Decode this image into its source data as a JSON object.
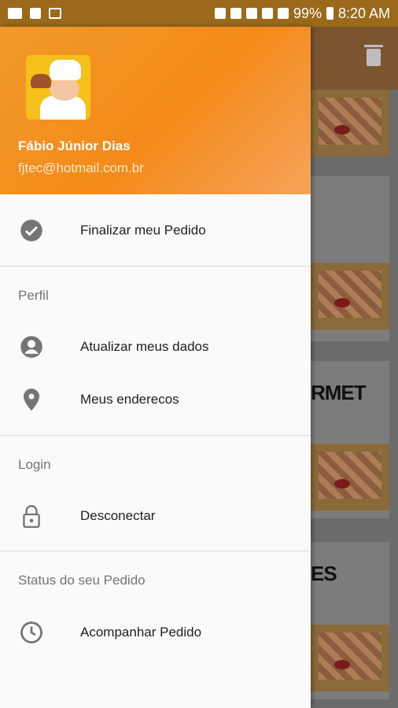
{
  "status_bar": {
    "battery": "99%",
    "time": "8:20 AM"
  },
  "drawer": {
    "user": {
      "name": "Fábio Júnior Dias",
      "email": "fjtec@hotmail.com.br"
    },
    "menu": {
      "finalize_order": "Finalizar meu Pedido",
      "profile_section": "Perfil",
      "update_data": "Atualizar meus dados",
      "my_addresses": "Meus enderecos",
      "login_section": "Login",
      "disconnect": "Desconectar",
      "order_status_section": "Status do seu Pedido",
      "track_order": "Acompanhar Pedido"
    }
  },
  "background_cards": {
    "card_text_1": "RMET",
    "card_text_2": "ES"
  },
  "icons": {
    "check": "check-circle-icon",
    "person": "account-circle-icon",
    "location": "location-pin-icon",
    "lock": "lock-icon",
    "clock": "clock-icon",
    "trash": "trash-icon"
  },
  "colors": {
    "header_start": "#f19a2a",
    "header_end": "#f5a35a",
    "icon_gray": "#757575"
  }
}
